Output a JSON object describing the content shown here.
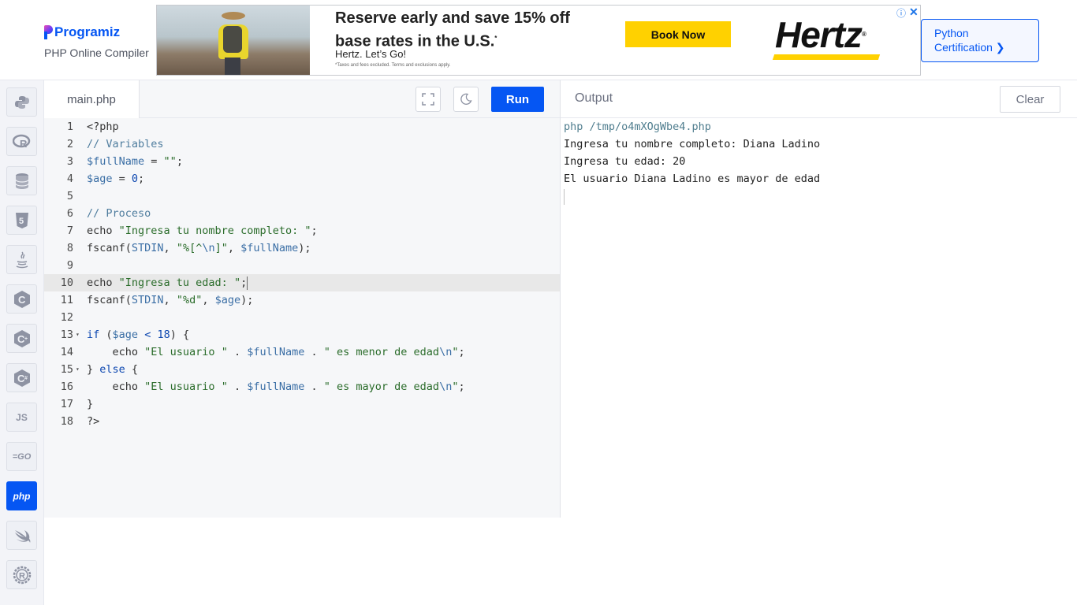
{
  "brand": {
    "name": "Programiz",
    "subtitle": "PHP Online Compiler"
  },
  "ad": {
    "headline": "Reserve early and save 15% off base rates in the U.S.",
    "headline_mark": "*",
    "tagline": "Hertz. Let’s Go!",
    "fine_print": "*Taxes and fees excluded. Terms and exclusions apply.",
    "cta": "Book Now",
    "brand": "Hertz",
    "brand_mark": "®",
    "info_icon": "ⓘ",
    "close_icon": "✕"
  },
  "certification": {
    "label_line1": "Python",
    "label_line2": "Certification ❯"
  },
  "sidebar": {
    "languages": [
      {
        "name": "python-icon",
        "glyph": ""
      },
      {
        "name": "r-icon",
        "glyph": "R"
      },
      {
        "name": "sql-icon",
        "glyph": ""
      },
      {
        "name": "html-icon",
        "glyph": "5"
      },
      {
        "name": "java-icon",
        "glyph": "☕"
      },
      {
        "name": "c-icon",
        "glyph": "C"
      },
      {
        "name": "cpp-icon",
        "glyph": "C+"
      },
      {
        "name": "csharp-icon",
        "glyph": "C#"
      },
      {
        "name": "js-icon",
        "glyph": "JS"
      },
      {
        "name": "go-icon",
        "glyph": "GO"
      },
      {
        "name": "php-icon",
        "glyph": "php"
      },
      {
        "name": "swift-icon",
        "glyph": "≫"
      },
      {
        "name": "rust-icon",
        "glyph": "R"
      }
    ]
  },
  "editor": {
    "tab_label": "main.php",
    "run_label": "Run",
    "line_numbers": [
      "1",
      "2",
      "3",
      "4",
      "5",
      "6",
      "7",
      "8",
      "9",
      "10",
      "11",
      "12",
      "13",
      "14",
      "15",
      "16",
      "17",
      "18"
    ]
  },
  "output": {
    "title": "Output",
    "clear_label": "Clear",
    "lines": [
      "php /tmp/o4mXOgWbe4.php",
      "Ingresa tu nombre completo: Diana Ladino",
      "Ingresa tu edad: 20",
      "El usuario Diana Ladino es mayor de edad"
    ]
  }
}
